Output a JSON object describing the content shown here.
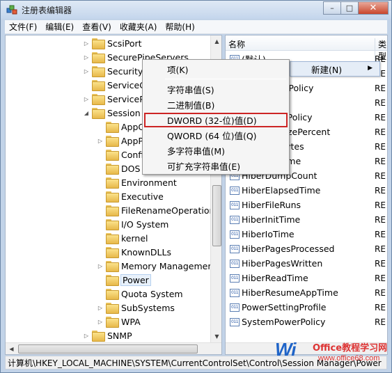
{
  "window": {
    "title": "注册表编辑器",
    "minimize": "–",
    "maximize": "□",
    "close": "✕"
  },
  "menubar": [
    "文件(F)",
    "编辑(E)",
    "查看(V)",
    "收藏夹(A)",
    "帮助(H)"
  ],
  "tree": [
    {
      "label": "ScsiPort",
      "expander": "▷",
      "indent": 1
    },
    {
      "label": "SecurePipeServers",
      "expander": "▷",
      "indent": 1
    },
    {
      "label": "SecurityProviders",
      "expander": "▷",
      "indent": 1
    },
    {
      "label": "ServiceGroupOrder",
      "expander": "",
      "indent": 1
    },
    {
      "label": "ServiceProvider",
      "expander": "▷",
      "indent": 1
    },
    {
      "label": "Session Manager",
      "expander": "◢",
      "indent": 1
    },
    {
      "label": "AppCompatCache",
      "expander": "",
      "indent": 2
    },
    {
      "label": "AppPatches",
      "expander": "▷",
      "indent": 2
    },
    {
      "label": "Configuration Manager",
      "expander": "",
      "indent": 2
    },
    {
      "label": "DOS Devices",
      "expander": "",
      "indent": 2
    },
    {
      "label": "Environment",
      "expander": "",
      "indent": 2
    },
    {
      "label": "Executive",
      "expander": "",
      "indent": 2
    },
    {
      "label": "FileRenameOperations",
      "expander": "",
      "indent": 2
    },
    {
      "label": "I/O System",
      "expander": "",
      "indent": 2
    },
    {
      "label": "kernel",
      "expander": "",
      "indent": 2
    },
    {
      "label": "KnownDLLs",
      "expander": "",
      "indent": 2
    },
    {
      "label": "Memory Management",
      "expander": "▷",
      "indent": 2
    },
    {
      "label": "Power",
      "expander": "",
      "indent": 2,
      "selected": true
    },
    {
      "label": "Quota System",
      "expander": "",
      "indent": 2
    },
    {
      "label": "SubSystems",
      "expander": "▷",
      "indent": 2
    },
    {
      "label": "WPA",
      "expander": "▷",
      "indent": 2
    },
    {
      "label": "SNMP",
      "expander": "▷",
      "indent": 1
    }
  ],
  "list": {
    "col_name": "名称",
    "col_type": "类型",
    "rows": [
      {
        "name": "(默认)",
        "type": "RE"
      },
      {
        "name": "",
        "type": "RE"
      },
      {
        "name": "AwayModePolicy",
        "type": "RE"
      },
      {
        "name": "",
        "type": "RE"
      },
      {
        "name": "CustomizePolicy",
        "type": "RE"
      },
      {
        "name": "HiberFileSizePercent",
        "type": "RE"
      },
      {
        "name": "HiberFileBytes",
        "type": "RE"
      },
      {
        "name": "HiberFileTime",
        "type": "RE"
      },
      {
        "name": "HiberDumpCount",
        "type": "RE"
      },
      {
        "name": "HiberElapsedTime",
        "type": "RE"
      },
      {
        "name": "HiberFileRuns",
        "type": "RE"
      },
      {
        "name": "HiberInitTime",
        "type": "RE"
      },
      {
        "name": "HiberIoTime",
        "type": "RE"
      },
      {
        "name": "HiberPagesProcessed",
        "type": "RE"
      },
      {
        "name": "HiberPagesWritten",
        "type": "RE"
      },
      {
        "name": "HiberReadTime",
        "type": "RE"
      },
      {
        "name": "HiberResumeAppTime",
        "type": "RE"
      },
      {
        "name": "PowerSettingProfile",
        "type": "RE"
      },
      {
        "name": "SystemPowerPolicy",
        "type": "RE"
      }
    ],
    "icon_text": "011"
  },
  "context_menu": {
    "items": [
      "项(K)",
      "字符串值(S)",
      "二进制值(B)",
      "DWORD (32-位)值(D)",
      "QWORD (64 位)值(Q)",
      "多字符串值(M)",
      "可扩充字符串值(E)"
    ]
  },
  "submenu_parent": {
    "label": "新建(N)",
    "arrow": "▶"
  },
  "statusbar": "计算机\\HKEY_LOCAL_MACHINE\\SYSTEM\\CurrentControlSet\\Control\\Session Manager\\Power",
  "watermark": {
    "main": "Wi",
    "sub": "Office教程学习网",
    "url": "www.office68.com"
  },
  "colors": {
    "highlight_border": "#cc2424",
    "selection": "#e8f1fb",
    "watermark_blue": "#1f64c8",
    "watermark_red": "#dd3333"
  }
}
